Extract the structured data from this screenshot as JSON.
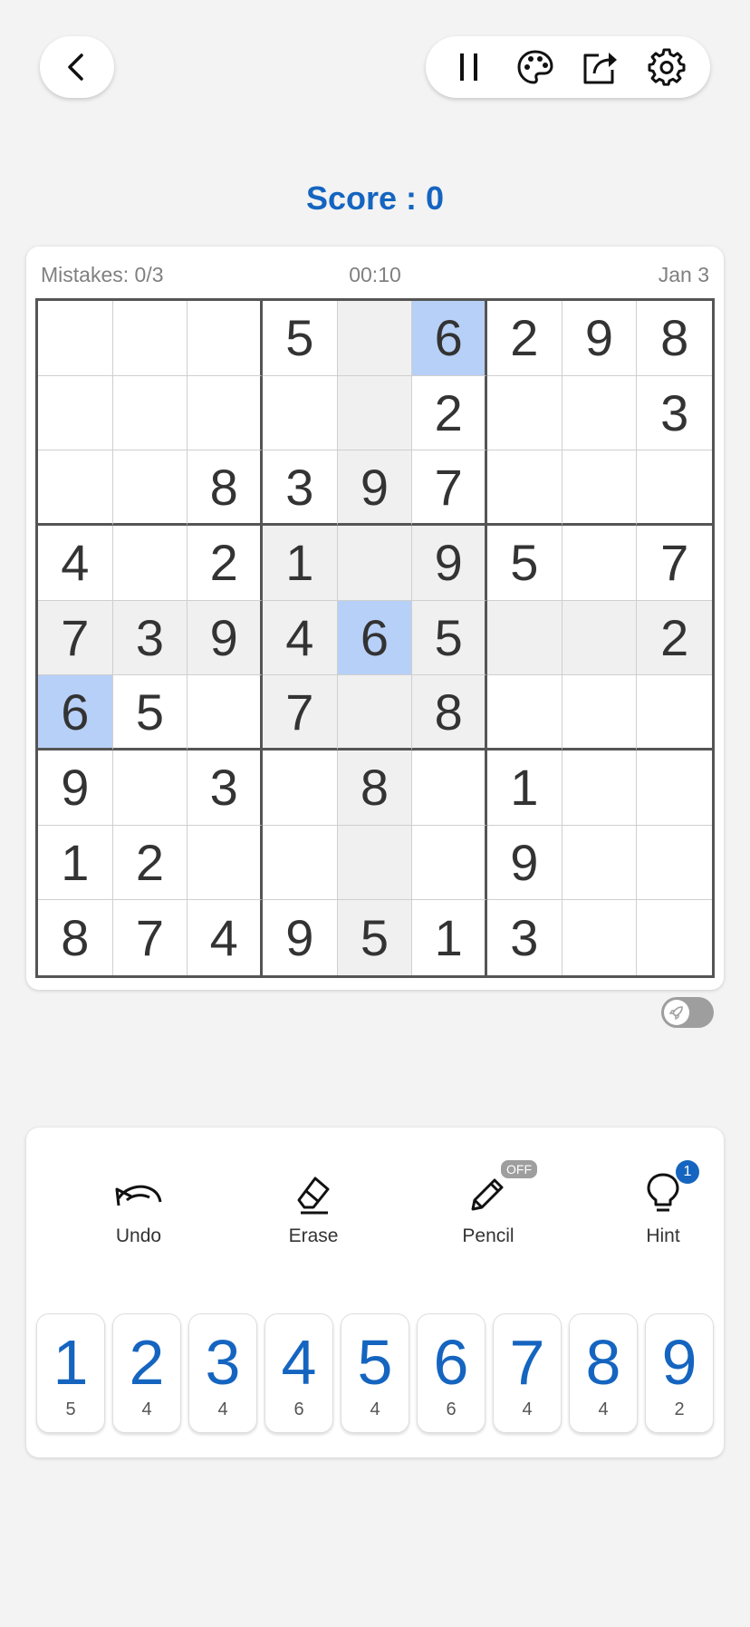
{
  "header": {
    "score": "Score : 0"
  },
  "info": {
    "mistakes": "Mistakes: 0/3",
    "timer": "00:10",
    "date": "Jan 3"
  },
  "colors": {
    "accent": "#1565c0",
    "selected": "#b7d0f7",
    "highlight": "#f0f0f0"
  },
  "board": [
    [
      "",
      "",
      "",
      "5",
      "",
      "6",
      "2",
      "9",
      "8"
    ],
    [
      "",
      "",
      "",
      "",
      "",
      "2",
      "",
      "",
      "3"
    ],
    [
      "",
      "",
      "8",
      "3",
      "9",
      "7",
      "",
      "",
      ""
    ],
    [
      "4",
      "",
      "2",
      "1",
      "",
      "9",
      "5",
      "",
      "7"
    ],
    [
      "7",
      "3",
      "9",
      "4",
      "6",
      "5",
      "",
      "",
      "2"
    ],
    [
      "6",
      "5",
      "",
      "7",
      "",
      "8",
      "",
      "",
      ""
    ],
    [
      "9",
      "",
      "3",
      "",
      "8",
      "",
      "1",
      "",
      ""
    ],
    [
      "1",
      "2",
      "",
      "",
      "",
      "",
      "9",
      "",
      ""
    ],
    [
      "8",
      "7",
      "4",
      "9",
      "5",
      "1",
      "3",
      "",
      ""
    ]
  ],
  "selected_cells": [
    [
      0,
      5
    ],
    [
      4,
      4
    ],
    [
      5,
      0
    ]
  ],
  "highlighted_cells": [
    [
      0,
      4
    ],
    [
      1,
      4
    ],
    [
      2,
      4
    ],
    [
      3,
      4
    ],
    [
      5,
      4
    ],
    [
      6,
      4
    ],
    [
      7,
      4
    ],
    [
      8,
      4
    ],
    [
      4,
      0
    ],
    [
      4,
      1
    ],
    [
      4,
      2
    ],
    [
      4,
      3
    ],
    [
      4,
      5
    ],
    [
      4,
      6
    ],
    [
      4,
      7
    ],
    [
      4,
      8
    ],
    [
      3,
      3
    ],
    [
      3,
      5
    ],
    [
      5,
      3
    ],
    [
      5,
      5
    ]
  ],
  "actions": {
    "undo": "Undo",
    "erase": "Erase",
    "pencil": "Pencil",
    "pencil_badge": "OFF",
    "hint": "Hint",
    "hint_badge": "1"
  },
  "numpad": [
    {
      "digit": "1",
      "count": "5"
    },
    {
      "digit": "2",
      "count": "4"
    },
    {
      "digit": "3",
      "count": "4"
    },
    {
      "digit": "4",
      "count": "6"
    },
    {
      "digit": "5",
      "count": "4"
    },
    {
      "digit": "6",
      "count": "6"
    },
    {
      "digit": "7",
      "count": "4"
    },
    {
      "digit": "8",
      "count": "4"
    },
    {
      "digit": "9",
      "count": "2"
    }
  ]
}
